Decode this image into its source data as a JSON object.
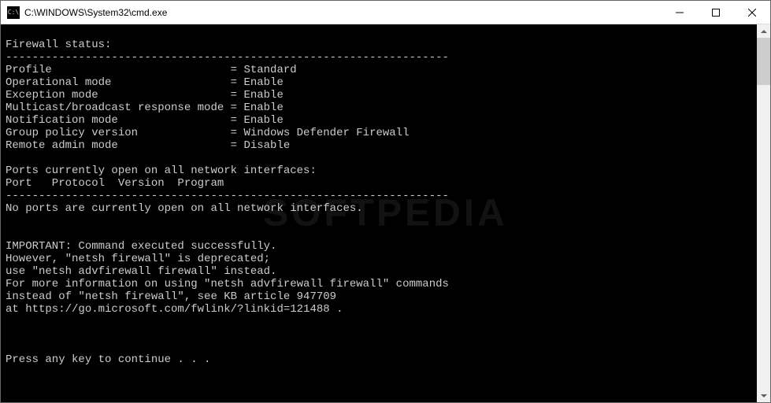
{
  "titlebar": {
    "icon_text": "C:\\",
    "title": "C:\\WINDOWS\\System32\\cmd.exe"
  },
  "console": {
    "lines": [
      "",
      "Firewall status:",
      "-------------------------------------------------------------------",
      "Profile                           = Standard",
      "Operational mode                  = Enable",
      "Exception mode                    = Enable",
      "Multicast/broadcast response mode = Enable",
      "Notification mode                 = Enable",
      "Group policy version              = Windows Defender Firewall",
      "Remote admin mode                 = Disable",
      "",
      "Ports currently open on all network interfaces:",
      "Port   Protocol  Version  Program",
      "-------------------------------------------------------------------",
      "No ports are currently open on all network interfaces.",
      "",
      "",
      "IMPORTANT: Command executed successfully.",
      "However, \"netsh firewall\" is deprecated;",
      "use \"netsh advfirewall firewall\" instead.",
      "For more information on using \"netsh advfirewall firewall\" commands",
      "instead of \"netsh firewall\", see KB article 947709",
      "at https://go.microsoft.com/fwlink/?linkid=121488 .",
      "",
      "",
      "",
      "Press any key to continue . . ."
    ]
  },
  "watermark": "SOFTPEDIA"
}
